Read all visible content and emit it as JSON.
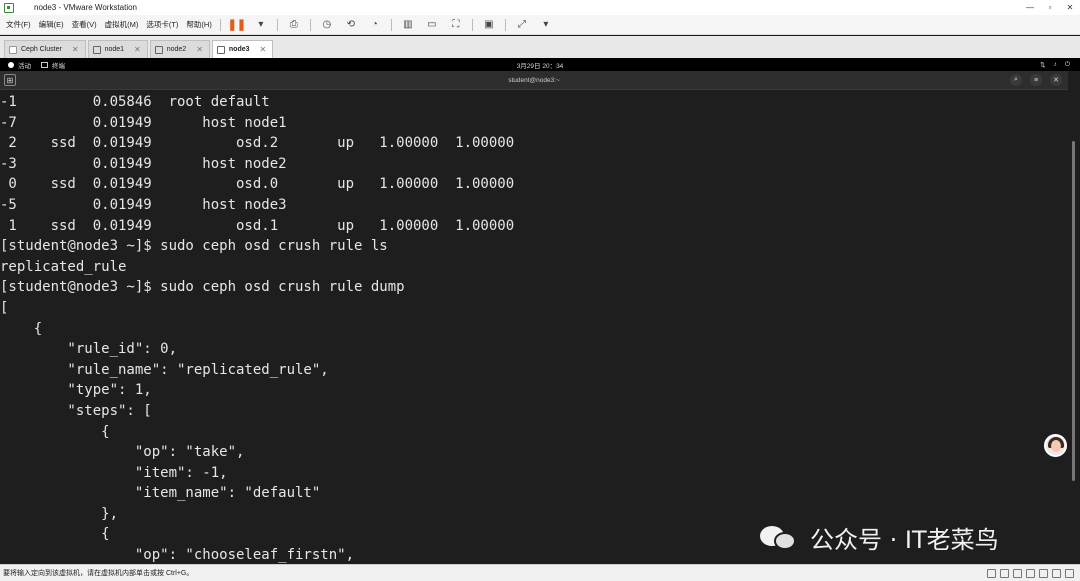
{
  "window": {
    "title": "node3 - VMware Workstation"
  },
  "menu": {
    "items": [
      "文件(F)",
      "编辑(E)",
      "查看(V)",
      "虚拟机(M)",
      "选项卡(T)",
      "帮助(H)"
    ]
  },
  "tabs": [
    {
      "label": "Ceph Cluster",
      "active": false
    },
    {
      "label": "node1",
      "active": false
    },
    {
      "label": "node2",
      "active": false
    },
    {
      "label": "node3",
      "active": true
    }
  ],
  "guest_panel": {
    "activities": "活动",
    "app": "终端",
    "clock": "3月29日 20：34"
  },
  "terminal": {
    "title": "student@node3:~",
    "lines": [
      "-1         0.05846  root default",
      "-7         0.01949      host node1",
      " 2    ssd  0.01949          osd.2       up   1.00000  1.00000",
      "-3         0.01949      host node2",
      " 0    ssd  0.01949          osd.0       up   1.00000  1.00000",
      "-5         0.01949      host node3",
      " 1    ssd  0.01949          osd.1       up   1.00000  1.00000",
      "[student@node3 ~]$ sudo ceph osd crush rule ls",
      "replicated_rule",
      "[student@node3 ~]$ sudo ceph osd crush rule dump",
      "[",
      "    {",
      "        \"rule_id\": 0,",
      "        \"rule_name\": \"replicated_rule\",",
      "        \"type\": 1,",
      "        \"steps\": [",
      "            {",
      "                \"op\": \"take\",",
      "                \"item\": -1,",
      "                \"item_name\": \"default\"",
      "            },",
      "            {",
      "                \"op\": \"chooseleaf_firstn\","
    ]
  },
  "watermark": {
    "text": "公众号 · IT老菜鸟"
  },
  "statusbar": {
    "text": "要将输入定向到该虚拟机，请在虚拟机内部单击或按 Ctrl+G。"
  }
}
